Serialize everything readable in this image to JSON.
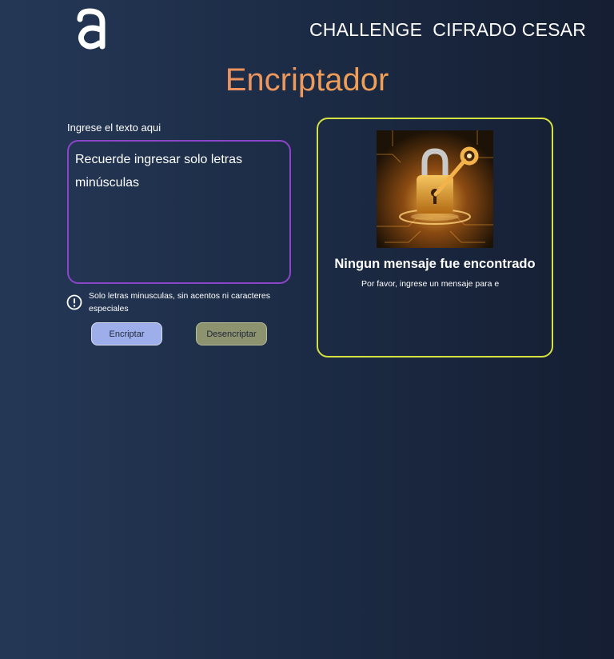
{
  "header": {
    "logo_icon": "alura-a-logo-icon",
    "site_title": "CHALLENGE  CIFRADO CESAR"
  },
  "main": {
    "heading": "Encriptador",
    "heading_gradient": [
      "#e47d6c",
      "#f1b545"
    ]
  },
  "input_section": {
    "label": "Ingrese el texto aqui",
    "textarea_placeholder": "Recuerde ingresar solo letras minúsculas",
    "textarea_value": "",
    "hint_icon": "exclamation-circle-icon",
    "hint_text": "Solo letras minusculas, sin acentos ni caracteres especiales"
  },
  "buttons": {
    "encrypt_label": "Encriptar",
    "decrypt_label": "Desencriptar"
  },
  "result_panel": {
    "image_icon": "padlock-key-image",
    "title": "Ningun mensaje fue encontrado",
    "subtitle": "Por favor, ingrese un mensaje para e"
  },
  "colors": {
    "textarea_border": "#8a45c9",
    "panel_border": "#d6e23f",
    "encrypt_button": "#9daeeb",
    "decrypt_button": "#8d926f"
  }
}
